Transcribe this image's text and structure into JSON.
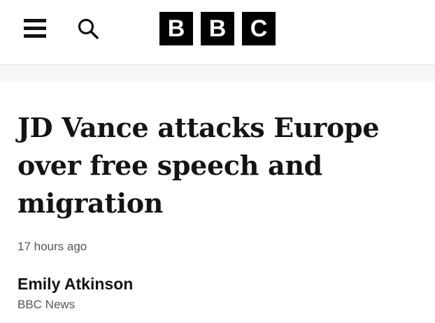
{
  "header": {
    "menu_icon": "hamburger-menu-icon",
    "search_icon": "search-icon",
    "logo_letters": [
      "B",
      "B",
      "C"
    ]
  },
  "article": {
    "headline": "JD Vance attacks Europe over free speech and migration",
    "timestamp": "17 hours ago",
    "author_name": "Emily Atkinson",
    "author_org": "BBC News"
  },
  "colors": {
    "logo_bg": "#000000",
    "logo_text": "#ffffff",
    "text_primary": "#141414",
    "text_secondary": "#545658"
  }
}
